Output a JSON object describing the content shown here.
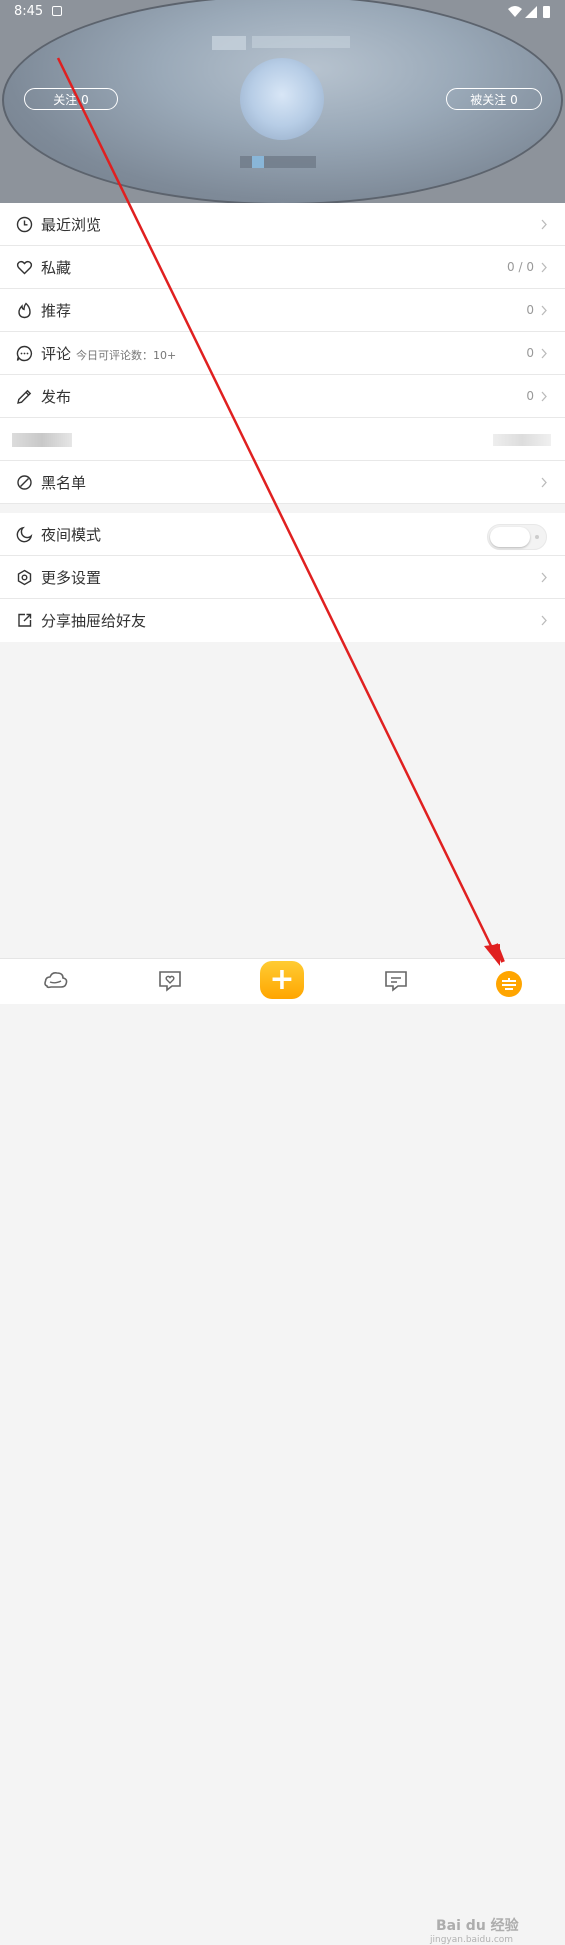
{
  "status_bar": {
    "time": "8:45"
  },
  "header": {
    "follow_label": "关注 0",
    "followers_label": "被关注 0"
  },
  "menu": {
    "recent": {
      "label": "最近浏览",
      "icon": "clock-icon"
    },
    "favorites": {
      "label": "私藏",
      "value": "0 / 0",
      "icon": "heart-icon"
    },
    "recommend": {
      "label": "推荐",
      "value": "0",
      "icon": "flame-icon"
    },
    "comments": {
      "label": "评论",
      "sub": "今日可评论数：10+",
      "value": "0",
      "icon": "chat-icon"
    },
    "publish": {
      "label": "发布",
      "value": "0",
      "icon": "pencil-icon"
    },
    "blacklist": {
      "label": "黑名单",
      "icon": "block-icon"
    }
  },
  "settings": {
    "night_mode": {
      "label": "夜间模式",
      "enabled": false,
      "icon": "moon-icon"
    },
    "more_settings": {
      "label": "更多设置",
      "icon": "gear-icon"
    },
    "share": {
      "label": "分享抽屉给好友",
      "icon": "share-icon"
    }
  },
  "bottom_nav": {
    "items": [
      "home-icon",
      "heart-chat-icon",
      "add-icon",
      "message-icon",
      "me-icon"
    ],
    "add_symbol": "+"
  },
  "watermark": {
    "text": "Bai du 经验",
    "sub": "jingyan.baidu.com"
  },
  "colors": {
    "accent": "#ffa500",
    "annotation": "#e02020"
  }
}
